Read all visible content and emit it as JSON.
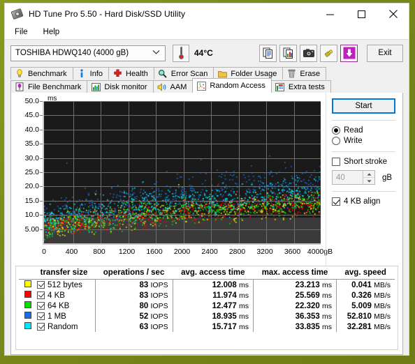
{
  "window": {
    "title": "HD Tune Pro 5.50 - Hard Disk/SSD Utility",
    "app_icon": "hard-disk-icon",
    "minimize": "—",
    "maximize": "□",
    "close": "✕"
  },
  "menu": {
    "items": [
      {
        "label": "File"
      },
      {
        "label": "Help"
      }
    ]
  },
  "toolbar": {
    "drive": "TOSHIBA HDWQ140 (4000 gB)",
    "temperature": "44°C",
    "exit_label": "Exit",
    "icons": [
      {
        "name": "copy-text-icon"
      },
      {
        "name": "copy-graph-icon"
      },
      {
        "name": "screenshot-camera-icon"
      },
      {
        "name": "plug-connector-icon"
      },
      {
        "name": "save-download-icon"
      }
    ]
  },
  "tabs": {
    "row1": [
      {
        "label": "Benchmark",
        "icon": "lightbulb-icon",
        "active": false
      },
      {
        "label": "Info",
        "icon": "info-icon",
        "active": false
      },
      {
        "label": "Health",
        "icon": "red-cross-icon",
        "active": false
      },
      {
        "label": "Error Scan",
        "icon": "magnifier-icon",
        "active": false
      },
      {
        "label": "Folder Usage",
        "icon": "folder-icon",
        "active": false
      },
      {
        "label": "Erase",
        "icon": "trash-icon",
        "active": false
      }
    ],
    "row2": [
      {
        "label": "File Benchmark",
        "icon": "file-benchmark-icon",
        "active": false
      },
      {
        "label": "Disk monitor",
        "icon": "bar-chart-icon",
        "active": false
      },
      {
        "label": "AAM",
        "icon": "speaker-icon",
        "active": false
      },
      {
        "label": "Random Access",
        "icon": "scatter-dots-icon",
        "active": true
      },
      {
        "label": "Extra tests",
        "icon": "extra-tests-icon",
        "active": false
      }
    ]
  },
  "controls": {
    "start_label": "Start",
    "read_label": "Read",
    "write_label": "Write",
    "mode_selected": "Read",
    "short_stroke_label": "Short stroke",
    "short_stroke_checked": false,
    "short_stroke_value": "40",
    "short_stroke_unit": "gB",
    "align_label": "4 KB align",
    "align_checked": true
  },
  "chart_data": {
    "type": "scatter",
    "title": "",
    "xlabel": "",
    "ylabel": "ms",
    "unit_label": "ms",
    "x_unit_suffix": "gB",
    "xlim": [
      0,
      4000
    ],
    "ylim": [
      0,
      50
    ],
    "grid": true,
    "x_ticks": [
      0,
      400,
      800,
      1200,
      1600,
      2000,
      2400,
      2800,
      3200,
      3600,
      4000
    ],
    "x_tick_labels": [
      "0",
      "400",
      "800",
      "1200",
      "1600",
      "2000",
      "2400",
      "2800",
      "3200",
      "3600",
      "4000gB"
    ],
    "y_ticks": [
      5,
      10,
      15,
      20,
      25,
      30,
      35,
      40,
      45,
      50
    ],
    "y_tick_labels": [
      "5.00",
      "10.0",
      "15.0",
      "20.0",
      "25.0",
      "30.0",
      "35.0",
      "40.0",
      "45.0",
      "50.0"
    ],
    "plot_background": "#1a1a1a",
    "grid_color": "#6e6e6e",
    "legend_position": "table-below",
    "series": [
      {
        "name": "512 bytes",
        "color": "#ffff00",
        "point_count": 500,
        "y_mean": 12.008,
        "y_max": 23.213
      },
      {
        "name": "4 KB",
        "color": "#ff0000",
        "point_count": 500,
        "y_mean": 11.974,
        "y_max": 25.569
      },
      {
        "name": "64 KB",
        "color": "#00e000",
        "point_count": 500,
        "y_mean": 12.477,
        "y_max": 22.32
      },
      {
        "name": "1 MB",
        "color": "#1a6fe0",
        "point_count": 500,
        "y_mean": 18.935,
        "y_max": 36.353
      },
      {
        "name": "Random",
        "color": "#00e8ff",
        "point_count": 500,
        "y_mean": 15.717,
        "y_max": 33.835
      }
    ]
  },
  "results": {
    "headers": [
      "transfer size",
      "operations / sec",
      "avg. access time",
      "max. access time",
      "avg. speed"
    ],
    "rows": [
      {
        "color": "#ffff00",
        "checked": true,
        "transfer_size": "512 bytes",
        "ops": "83",
        "ops_unit": "IOPS",
        "avg_access": "12.008",
        "avg_access_unit": "ms",
        "max_access": "23.213",
        "max_access_unit": "ms",
        "avg_speed": "0.041",
        "avg_speed_unit": "MB/s"
      },
      {
        "color": "#ff0000",
        "checked": true,
        "transfer_size": "4 KB",
        "ops": "83",
        "ops_unit": "IOPS",
        "avg_access": "11.974",
        "avg_access_unit": "ms",
        "max_access": "25.569",
        "max_access_unit": "ms",
        "avg_speed": "0.326",
        "avg_speed_unit": "MB/s"
      },
      {
        "color": "#00e000",
        "checked": true,
        "transfer_size": "64 KB",
        "ops": "80",
        "ops_unit": "IOPS",
        "avg_access": "12.477",
        "avg_access_unit": "ms",
        "max_access": "22.320",
        "max_access_unit": "ms",
        "avg_speed": "5.009",
        "avg_speed_unit": "MB/s"
      },
      {
        "color": "#1a6fe0",
        "checked": true,
        "transfer_size": "1 MB",
        "ops": "52",
        "ops_unit": "IOPS",
        "avg_access": "18.935",
        "avg_access_unit": "ms",
        "max_access": "36.353",
        "max_access_unit": "ms",
        "avg_speed": "52.810",
        "avg_speed_unit": "MB/s"
      },
      {
        "color": "#00e8ff",
        "checked": true,
        "transfer_size": "Random",
        "ops": "63",
        "ops_unit": "IOPS",
        "avg_access": "15.717",
        "avg_access_unit": "ms",
        "max_access": "33.835",
        "max_access_unit": "ms",
        "avg_speed": "32.281",
        "avg_speed_unit": "MB/s"
      }
    ]
  }
}
